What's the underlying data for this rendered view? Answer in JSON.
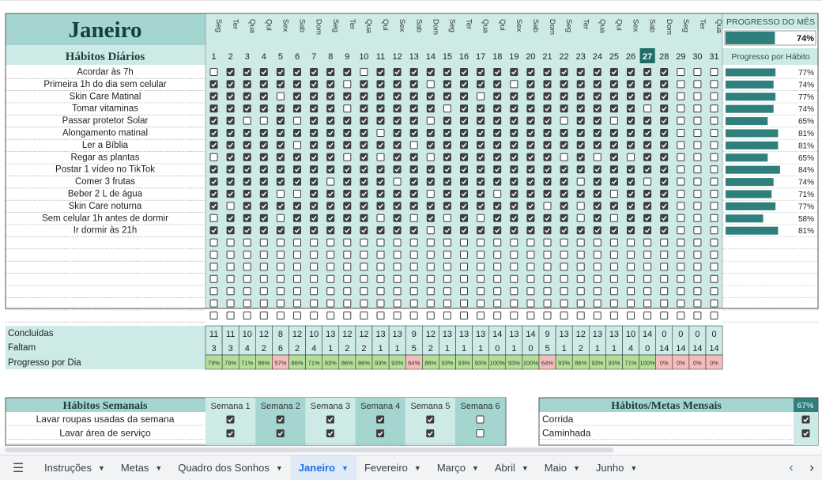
{
  "month": {
    "title": "Janeiro",
    "habits_header": "Hábitos Diários",
    "progress_month_label": "PROGRESSO DO MÊS",
    "progress_month_value": "74%",
    "progress_month_fraction": 0.74,
    "progress_per_habit_label": "Progresso por Hábito",
    "weekdays": [
      "Seg",
      "Ter",
      "Qua",
      "Qui",
      "Sex",
      "Sab",
      "Dom",
      "Seg",
      "Ter",
      "Qua",
      "Qui",
      "Sex",
      "Sab",
      "Dom",
      "Seg",
      "Ter",
      "Qua",
      "Qui",
      "Sex",
      "Sab",
      "Dom",
      "Seg",
      "Ter",
      "Qua",
      "Qui",
      "Sex",
      "Sab",
      "Dom",
      "Seg",
      "Ter",
      "Qua"
    ],
    "days": [
      "1",
      "2",
      "3",
      "4",
      "5",
      "6",
      "7",
      "8",
      "9",
      "10",
      "11",
      "12",
      "13",
      "14",
      "15",
      "16",
      "17",
      "18",
      "19",
      "20",
      "21",
      "22",
      "23",
      "24",
      "25",
      "26",
      "27",
      "28",
      "29",
      "30",
      "31"
    ],
    "today": "27",
    "habits": [
      {
        "name": "Acordar às 7h",
        "progress": "77%",
        "fraction": 0.77,
        "checks": "0111111110111111111111111111000"
      },
      {
        "name": "Primeira 1h do dia sem celular",
        "progress": "74%",
        "fraction": 0.74,
        "checks": "1111111101111011110111111111000"
      },
      {
        "name": "Skin Care Matinal",
        "progress": "77%",
        "fraction": 0.77,
        "checks": "1111011111111111011111111111000"
      },
      {
        "name": "Tomar vitaminas",
        "progress": "74%",
        "fraction": 0.74,
        "checks": "1111111101111101111111111101000"
      },
      {
        "name": "Passar protetor Solar",
        "progress": "65%",
        "fraction": 0.65,
        "checks": "1100101111111011111110110111000"
      },
      {
        "name": "Alongamento matinal",
        "progress": "81%",
        "fraction": 0.81,
        "checks": "1111111111011111111111111111000"
      },
      {
        "name": "Ler a Bíblia",
        "progress": "81%",
        "fraction": 0.81,
        "checks": "1111101111110111111111111111000"
      },
      {
        "name": "Regar as plantas",
        "progress": "65%",
        "fraction": 0.65,
        "checks": "0111111101011011111110101011000"
      },
      {
        "name": "Postar 1 vídeo no TikTok",
        "progress": "84%",
        "fraction": 0.84,
        "checks": "1111111111111111111111111111000"
      },
      {
        "name": "Comer 3 frutas",
        "progress": "74%",
        "fraction": 0.74,
        "checks": "1111111011101111111111011101000"
      },
      {
        "name": "Beber 2 L de água",
        "progress": "71%",
        "fraction": 0.71,
        "checks": "1111001111111011101111110111000"
      },
      {
        "name": "Skin Care noturna",
        "progress": "77%",
        "fraction": 0.77,
        "checks": "1011111111111111111101011111000"
      },
      {
        "name": "Sem celular 1h antes de dormir",
        "progress": "58%",
        "fraction": 0.58,
        "checks": "0111011111010101011111010111000"
      },
      {
        "name": "Ir dormir às 21h",
        "progress": "81%",
        "fraction": 0.81,
        "checks": "1111111111111011111111111111000"
      }
    ],
    "empty_rows": 7
  },
  "summary": {
    "concluidas_label": "Concluídas",
    "faltam_label": "Faltam",
    "progresso_dia_label": "Progresso por Dia",
    "concluidas": [
      "11",
      "11",
      "10",
      "12",
      "8",
      "12",
      "10",
      "13",
      "12",
      "12",
      "13",
      "13",
      "9",
      "12",
      "13",
      "13",
      "13",
      "14",
      "13",
      "14",
      "9",
      "13",
      "12",
      "13",
      "13",
      "10",
      "14",
      "0",
      "0",
      "0",
      "0"
    ],
    "faltam": [
      "3",
      "3",
      "4",
      "2",
      "6",
      "2",
      "4",
      "1",
      "2",
      "2",
      "1",
      "1",
      "5",
      "2",
      "1",
      "1",
      "1",
      "0",
      "1",
      "0",
      "5",
      "1",
      "2",
      "1",
      "1",
      "4",
      "0",
      "14",
      "14",
      "14",
      "14"
    ],
    "progresso": [
      "79%",
      "79%",
      "71%",
      "86%",
      "57%",
      "86%",
      "71%",
      "93%",
      "86%",
      "86%",
      "93%",
      "93%",
      "64%",
      "86%",
      "93%",
      "93%",
      "93%",
      "100%",
      "93%",
      "100%",
      "64%",
      "93%",
      "86%",
      "93%",
      "93%",
      "71%",
      "100%",
      "0%",
      "0%",
      "0%",
      "0%"
    ]
  },
  "weekly": {
    "title": "Hábitos Semanais",
    "weeks": [
      "Semana 1",
      "Semana 2",
      "Semana 3",
      "Semana 4",
      "Semana 5",
      "Semana 6"
    ],
    "habits": [
      {
        "name": "Lavar roupas usadas da semana",
        "checks": "111110"
      },
      {
        "name": "Lavar área de serviço",
        "checks": "111110"
      }
    ]
  },
  "monthly": {
    "title": "Hábitos/Metas Mensais",
    "progress": "67%",
    "items": [
      {
        "name": "Corrida",
        "checked": true
      },
      {
        "name": "Caminhada",
        "checked": true
      }
    ]
  },
  "colors": {
    "teal_light": "#cdeae6",
    "teal_header": "#a5d5d0",
    "teal_dark": "#2f7f7c",
    "today_bg": "#1f6e68",
    "green_pct": "#b4df98",
    "red_pct": "#f4bcbc"
  },
  "sheet_tabs": [
    {
      "label": "Instruções",
      "active": false
    },
    {
      "label": "Metas",
      "active": false
    },
    {
      "label": "Quadro dos Sonhos",
      "active": false
    },
    {
      "label": "Janeiro",
      "active": true
    },
    {
      "label": "Fevereiro",
      "active": false
    },
    {
      "label": "Março",
      "active": false
    },
    {
      "label": "Abril",
      "active": false
    },
    {
      "label": "Maio",
      "active": false
    },
    {
      "label": "Junho",
      "active": false
    }
  ],
  "icons": {
    "menu": "sheets-menu-icon",
    "prev": "chevron-left-icon",
    "next": "chevron-right-icon"
  }
}
